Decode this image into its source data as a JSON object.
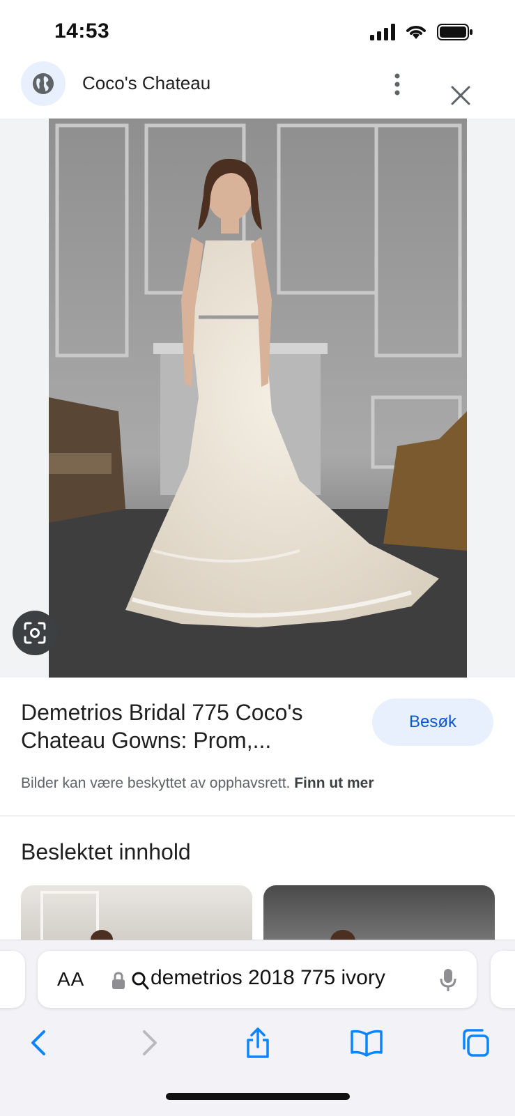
{
  "status_bar": {
    "time": "14:53",
    "icons": [
      "signal-icon",
      "wifi-icon",
      "battery-icon"
    ]
  },
  "header": {
    "site_name": "Coco's Chateau",
    "icons": [
      "globe-icon",
      "more-vert-icon",
      "close-icon"
    ]
  },
  "image": {
    "description_icon": "lens-icon"
  },
  "result": {
    "title": "Demetrios Bridal 775 Coco's Chateau Gowns: Prom,...",
    "visit_label": "Besøk",
    "copyright_text": "Bilder kan være beskyttet av opphavsrett.",
    "learn_more": "Finn ut mer"
  },
  "related": {
    "heading": "Beslektet innhold"
  },
  "browser": {
    "text_size_label": "AA",
    "url_text": "demetrios 2018 775 ivory",
    "nav_icons": [
      "back-icon",
      "forward-icon",
      "share-icon",
      "bookmarks-icon",
      "tabs-icon"
    ]
  },
  "colors": {
    "accent": "#0b57d0",
    "accent_bg": "#e8f0fe",
    "toolbar_bg": "#f2f2f7"
  }
}
